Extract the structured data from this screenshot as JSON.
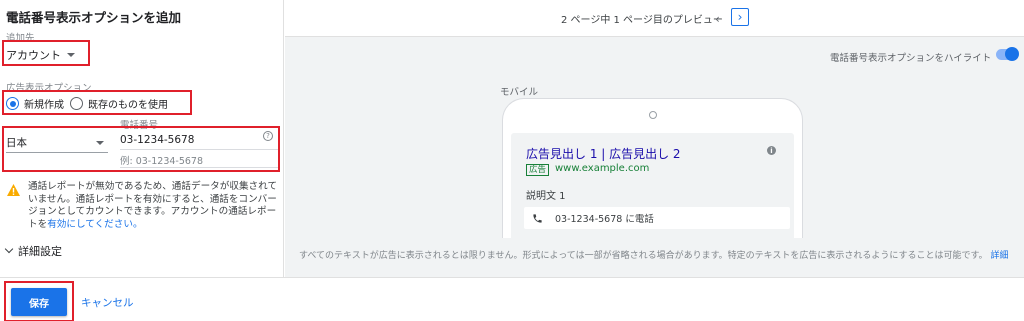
{
  "panel": {
    "title": "電話番号表示オプションを追加",
    "add_to_label": "追加先",
    "add_to_value": "アカウント",
    "ad_option_label": "広告表示オプション",
    "radio_new": "新規作成",
    "radio_existing": "既存のものを使用",
    "phone_label": "電話番号",
    "country": "日本",
    "phone_value": "03-1234-5678",
    "phone_example": "例: 03-1234-5678",
    "help_glyph": "?",
    "warning_text": "通話レポートが無効であるため、通話データが収集されていません。通話レポートを有効にすると、通話をコンバージョンとしてカウントできます。アカウントの通話レポートを",
    "warning_link": "有効にしてください。",
    "advanced": "詳細設定"
  },
  "preview": {
    "pager": "2 ページ中 1 ページ目のプレビュー",
    "highlight_label": "電話番号表示オプションをハイライト",
    "mobile_label": "モバイル",
    "ad": {
      "headline": "広告見出し 1 | 広告見出し 2",
      "badge": "広告",
      "url": "www.example.com",
      "description": "説明文 1",
      "call_text": "03-1234-5678 に電話"
    },
    "disclaimer": "すべてのテキストが広告に表示されるとは限りません。形式によっては一部が省略される場合があります。特定のテキストを広告に表示されるようにすることは可能です。",
    "disclaimer_link": "詳細"
  },
  "footer": {
    "save": "保存",
    "cancel": "キャンセル"
  },
  "colors": {
    "accent": "#1a73e8",
    "highlight_box": "#e0202b",
    "ad_green": "#188038",
    "warning": "#f9ab00"
  },
  "icons": [
    "dropdown-arrow-icon",
    "help-icon",
    "warning-icon",
    "chevron-down-icon",
    "chevron-left-icon",
    "chevron-right-icon",
    "info-icon",
    "phone-icon"
  ]
}
